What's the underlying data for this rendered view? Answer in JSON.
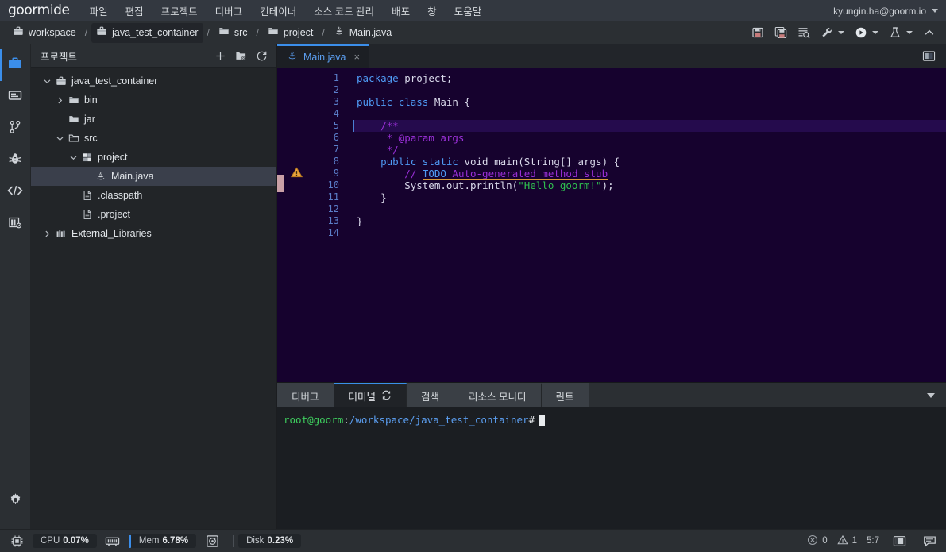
{
  "menubar": {
    "logo": "goormide",
    "items": [
      {
        "label": "파일"
      },
      {
        "label": "편집"
      },
      {
        "label": "프로젝트"
      },
      {
        "label": "디버그"
      },
      {
        "label": "컨테이너"
      },
      {
        "label": "소스 코드 관리"
      },
      {
        "label": "배포"
      },
      {
        "label": "창"
      },
      {
        "label": "도움말"
      }
    ],
    "user_email": "kyungin.ha@goorm.io"
  },
  "breadcrumb": {
    "items": [
      {
        "label": "workspace",
        "icon": "briefcase-icon",
        "active": false
      },
      {
        "label": "java_test_container",
        "icon": "briefcase-icon",
        "active": true
      },
      {
        "label": "src",
        "icon": "folder-icon",
        "active": false
      },
      {
        "label": "project",
        "icon": "folder-icon",
        "active": false
      },
      {
        "label": "Main.java",
        "icon": "java-icon",
        "active": false
      }
    ],
    "separator": "/",
    "tools": [
      {
        "name": "save-icon",
        "caret": false
      },
      {
        "name": "save-all-icon",
        "caret": false
      },
      {
        "name": "find-in-file-icon",
        "caret": false
      },
      {
        "name": "build-wrench-icon",
        "caret": true
      },
      {
        "name": "run-icon",
        "caret": true
      },
      {
        "name": "test-flask-icon",
        "caret": true
      },
      {
        "name": "collapse-chevron-icon",
        "caret": false
      }
    ]
  },
  "rail": {
    "items": [
      {
        "name": "project-workspace-icon",
        "active": true
      },
      {
        "name": "outline-icon",
        "active": false
      },
      {
        "name": "git-branch-icon",
        "active": false
      },
      {
        "name": "debug-bug-icon",
        "active": false
      },
      {
        "name": "code-snippet-icon",
        "active": false
      },
      {
        "name": "extensions-icon",
        "active": false
      }
    ],
    "bottom": {
      "name": "settings-gear-icon"
    }
  },
  "sidebar": {
    "title": "프로젝트",
    "actions": [
      {
        "name": "add-plus-icon"
      },
      {
        "name": "new-folder-settings-icon"
      },
      {
        "name": "refresh-icon"
      }
    ],
    "tree": [
      {
        "label": "java_test_container",
        "icon": "briefcase-icon",
        "depth": 0,
        "twisty": "down",
        "selected": false
      },
      {
        "label": "bin",
        "icon": "folder-icon",
        "depth": 1,
        "twisty": "right",
        "selected": false
      },
      {
        "label": "jar",
        "icon": "folder-icon",
        "depth": 1,
        "twisty": "none",
        "selected": false
      },
      {
        "label": "src",
        "icon": "folder-open-icon",
        "depth": 1,
        "twisty": "down",
        "selected": false
      },
      {
        "label": "project",
        "icon": "package-icon",
        "depth": 2,
        "twisty": "down",
        "selected": false
      },
      {
        "label": "Main.java",
        "icon": "java-icon",
        "depth": 3,
        "twisty": "none",
        "selected": true
      },
      {
        "label": ".classpath",
        "icon": "file-icon",
        "depth": 2,
        "twisty": "none",
        "selected": false
      },
      {
        "label": ".project",
        "icon": "file-icon",
        "depth": 2,
        "twisty": "none",
        "selected": false
      },
      {
        "label": "External_Libraries",
        "icon": "library-icon",
        "depth": 0,
        "twisty": "right",
        "selected": false
      }
    ]
  },
  "editor": {
    "tabs": [
      {
        "label": "Main.java",
        "icon": "java-icon",
        "active": true,
        "close": "×"
      }
    ],
    "split_icon": "split-editor-icon",
    "line_numbers": [
      "1",
      "2",
      "3",
      "4",
      "5",
      "6",
      "7",
      "8",
      "9",
      "10",
      "11",
      "12",
      "13",
      "14"
    ],
    "fold_lines": [
      3,
      5,
      8
    ],
    "active_line": 5,
    "warning_line": 9,
    "lines": [
      {
        "n": 1,
        "segments": [
          {
            "t": "package",
            "c": "k"
          },
          {
            "t": " ",
            "c": "plain"
          },
          {
            "t": "project;",
            "c": "plain"
          }
        ]
      },
      {
        "n": 2,
        "segments": []
      },
      {
        "n": 3,
        "segments": [
          {
            "t": "public",
            "c": "k"
          },
          {
            "t": " ",
            "c": "plain"
          },
          {
            "t": "class",
            "c": "k"
          },
          {
            "t": " Main {",
            "c": "plain"
          }
        ]
      },
      {
        "n": 4,
        "segments": []
      },
      {
        "n": 5,
        "segments": [
          {
            "t": "    /**",
            "c": "cmt"
          }
        ]
      },
      {
        "n": 6,
        "segments": [
          {
            "t": "     * @param args",
            "c": "cmt"
          }
        ]
      },
      {
        "n": 7,
        "segments": [
          {
            "t": "     */",
            "c": "cmt"
          }
        ]
      },
      {
        "n": 8,
        "segments": [
          {
            "t": "    ",
            "c": "plain"
          },
          {
            "t": "public",
            "c": "k"
          },
          {
            "t": " ",
            "c": "plain"
          },
          {
            "t": "static",
            "c": "k"
          },
          {
            "t": " ",
            "c": "plain"
          },
          {
            "t": "void",
            "c": "plain"
          },
          {
            "t": " main(String[] args) {",
            "c": "plain"
          }
        ]
      },
      {
        "n": 9,
        "segments": [
          {
            "t": "        ",
            "c": "plain"
          },
          {
            "t": "// ",
            "c": "cmt"
          },
          {
            "t": "TODO",
            "c": "todo"
          },
          {
            "t": " Auto-generated method stub",
            "c": "todo-rest"
          }
        ]
      },
      {
        "n": 10,
        "segments": [
          {
            "t": "        System.out.println(",
            "c": "plain"
          },
          {
            "t": "\"Hello goorm!\"",
            "c": "str"
          },
          {
            "t": ");",
            "c": "plain"
          }
        ]
      },
      {
        "n": 11,
        "segments": [
          {
            "t": "    }",
            "c": "plain"
          }
        ]
      },
      {
        "n": 12,
        "segments": []
      },
      {
        "n": 13,
        "segments": [
          {
            "t": "}",
            "c": "plain"
          }
        ]
      },
      {
        "n": 14,
        "segments": []
      }
    ]
  },
  "panel": {
    "tabs": [
      {
        "label": "디버그",
        "active": false,
        "icon": null
      },
      {
        "label": "터미널",
        "active": true,
        "icon": "terminal-reload-icon"
      },
      {
        "label": "검색",
        "active": false,
        "icon": null
      },
      {
        "label": "리소스 모니터",
        "active": false,
        "icon": null
      },
      {
        "label": "린트",
        "active": false,
        "icon": null
      }
    ],
    "collapse_icon": "chevron-down-icon",
    "terminal": {
      "user": "root@goorm",
      "colon": ":",
      "path": "/workspace/java_test_container",
      "hash": "#"
    }
  },
  "statusbar": {
    "cpu_label": "CPU",
    "cpu_value": "0.07%",
    "mem_label": "Mem",
    "mem_value": "6.78%",
    "disk_label": "Disk",
    "disk_value": "0.23%",
    "error_count": "0",
    "warning_count": "1",
    "cursor_position": "5:7"
  },
  "colors": {
    "accent_blue": "#3b8eea",
    "editor_bg": "#16022e",
    "active_line": "#250b4d",
    "chrome_bg": "#2b2f33",
    "sidebar_bg": "#222528",
    "string_green": "#2fbf4f",
    "comment_purple": "#9b30d9",
    "warning_orange": "#e8a33d"
  }
}
